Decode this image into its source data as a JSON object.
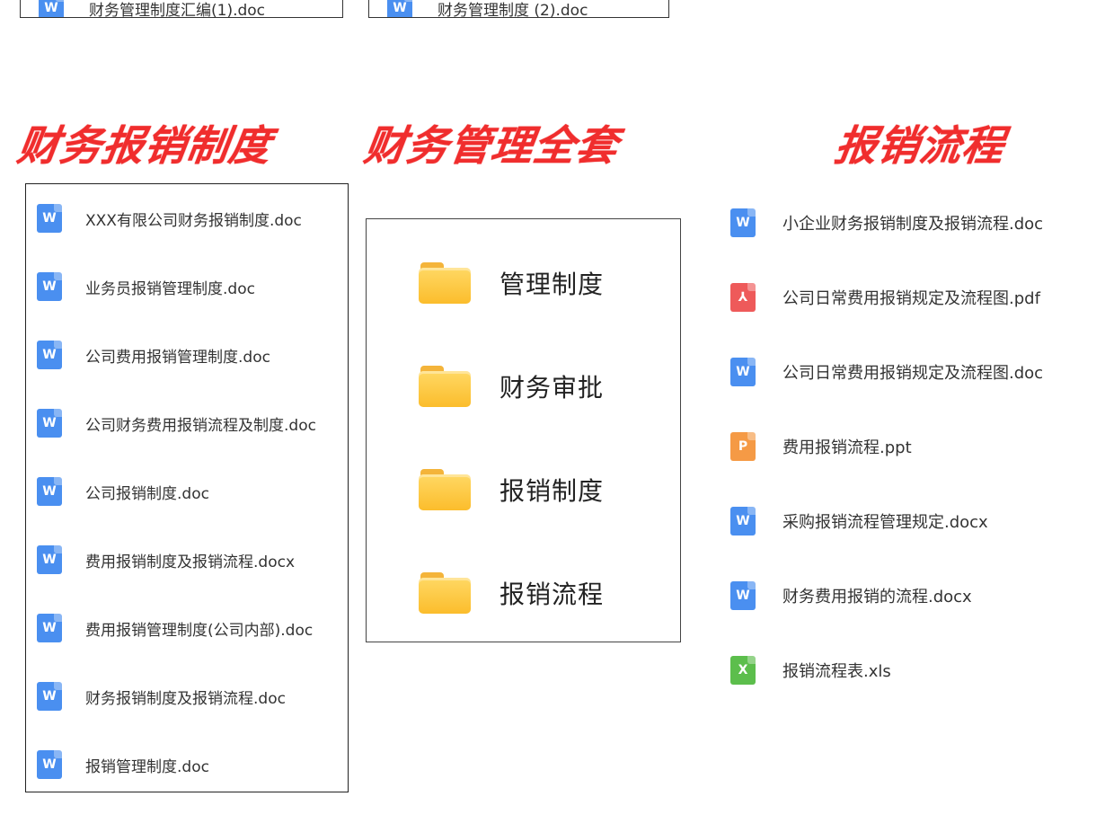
{
  "top": {
    "left_file": "财务管理制度汇编(1).doc",
    "mid_file": "财务管理制度 (2).doc"
  },
  "titles": {
    "left": "财务报销制度",
    "mid": "财务管理全套",
    "right": "报销流程"
  },
  "left_list": [
    {
      "name": "XXX有限公司财务报销制度.doc",
      "type": "doc"
    },
    {
      "name": "业务员报销管理制度.doc",
      "type": "doc"
    },
    {
      "name": "公司费用报销管理制度.doc",
      "type": "doc"
    },
    {
      "name": "公司财务费用报销流程及制度.doc",
      "type": "doc"
    },
    {
      "name": "公司报销制度.doc",
      "type": "doc"
    },
    {
      "name": "费用报销制度及报销流程.docx",
      "type": "doc"
    },
    {
      "name": "费用报销管理制度(公司内部).doc",
      "type": "doc"
    },
    {
      "name": "财务报销制度及报销流程.doc",
      "type": "doc"
    },
    {
      "name": "报销管理制度.doc",
      "type": "doc"
    }
  ],
  "folders": [
    {
      "name": "管理制度"
    },
    {
      "name": "财务审批"
    },
    {
      "name": "报销制度"
    },
    {
      "name": "报销流程"
    }
  ],
  "right_list": [
    {
      "name": "小企业财务报销制度及报销流程.doc",
      "type": "doc"
    },
    {
      "name": "公司日常费用报销规定及流程图.pdf",
      "type": "pdf"
    },
    {
      "name": "公司日常费用报销规定及流程图.doc",
      "type": "doc"
    },
    {
      "name": "费用报销流程.ppt",
      "type": "ppt"
    },
    {
      "name": "采购报销流程管理规定.docx",
      "type": "doc"
    },
    {
      "name": "财务费用报销的流程.docx",
      "type": "doc"
    },
    {
      "name": "报销流程表.xls",
      "type": "xls"
    }
  ],
  "icons": {
    "doc": {
      "glyph": "W",
      "color": "#4a8ff0",
      "name": "word-file-icon"
    },
    "pdf": {
      "glyph": "⅄",
      "color": "#ee5a5a",
      "name": "pdf-file-icon"
    },
    "ppt": {
      "glyph": "P",
      "color": "#f59a45",
      "name": "powerpoint-file-icon"
    },
    "xls": {
      "glyph": "X",
      "color": "#5cbe4c",
      "name": "excel-file-icon"
    }
  },
  "colors": {
    "title_red": "#f02d2d",
    "folder_yellow": "#fbbd2c"
  }
}
